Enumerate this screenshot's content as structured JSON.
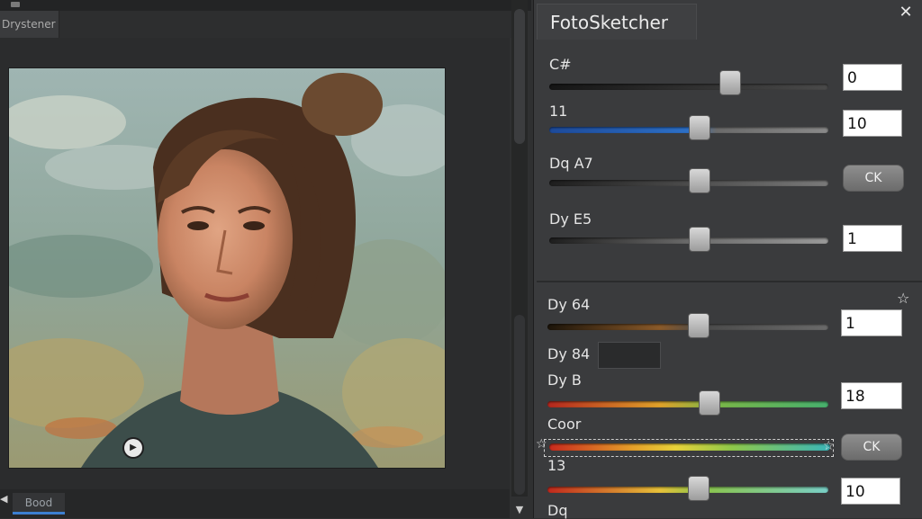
{
  "app": {
    "title": "FotoSketcher"
  },
  "document_tab": {
    "label": "Drystener"
  },
  "bottom_tab": {
    "label": "Bood"
  },
  "sliders": [
    {
      "id": "c",
      "label": "C#",
      "value": "0",
      "level": 0.53,
      "gradient": "gray",
      "control": "input"
    },
    {
      "id": "11",
      "label": "11",
      "value": "10",
      "level": 0.53,
      "gradient": "blue",
      "control": "input"
    },
    {
      "id": "dqa7",
      "label": "Dq A7",
      "value": "",
      "level": 0.53,
      "gradient": "gray",
      "control": "ok"
    },
    {
      "id": "dye5",
      "label": "Dy E5",
      "value": "1",
      "level": 0.53,
      "gradient": "gray",
      "control": "input"
    },
    {
      "id": "dy64",
      "label": "Dy 64",
      "value": "1",
      "level": 0.53,
      "gradient": "brown",
      "control": "input"
    },
    {
      "id": "dyb",
      "label": "Dy B",
      "value": "18",
      "level": 0.57,
      "gradient": "redgreen",
      "control": "input"
    },
    {
      "id": "coor",
      "label": "Coor",
      "value": "",
      "level": 1.0,
      "gradient": "spectrum",
      "control": "ok"
    },
    {
      "id": "13",
      "label": "13",
      "value": "10",
      "level": 0.53,
      "gradient": "spectrum2",
      "control": "input"
    }
  ],
  "swatch_label": "Dy 84",
  "ok_label": "CK",
  "bottom_partial_label": "Dq",
  "icons": {
    "close": "close-icon",
    "play": "play-icon",
    "star": "star-icon",
    "scroll_down": "chevron-down-icon",
    "scroll_left": "chevron-left-icon"
  },
  "colors": {
    "panel": "#3a3b3d",
    "canvas": "#2b2c2d",
    "accent": "#3d7fd1"
  }
}
